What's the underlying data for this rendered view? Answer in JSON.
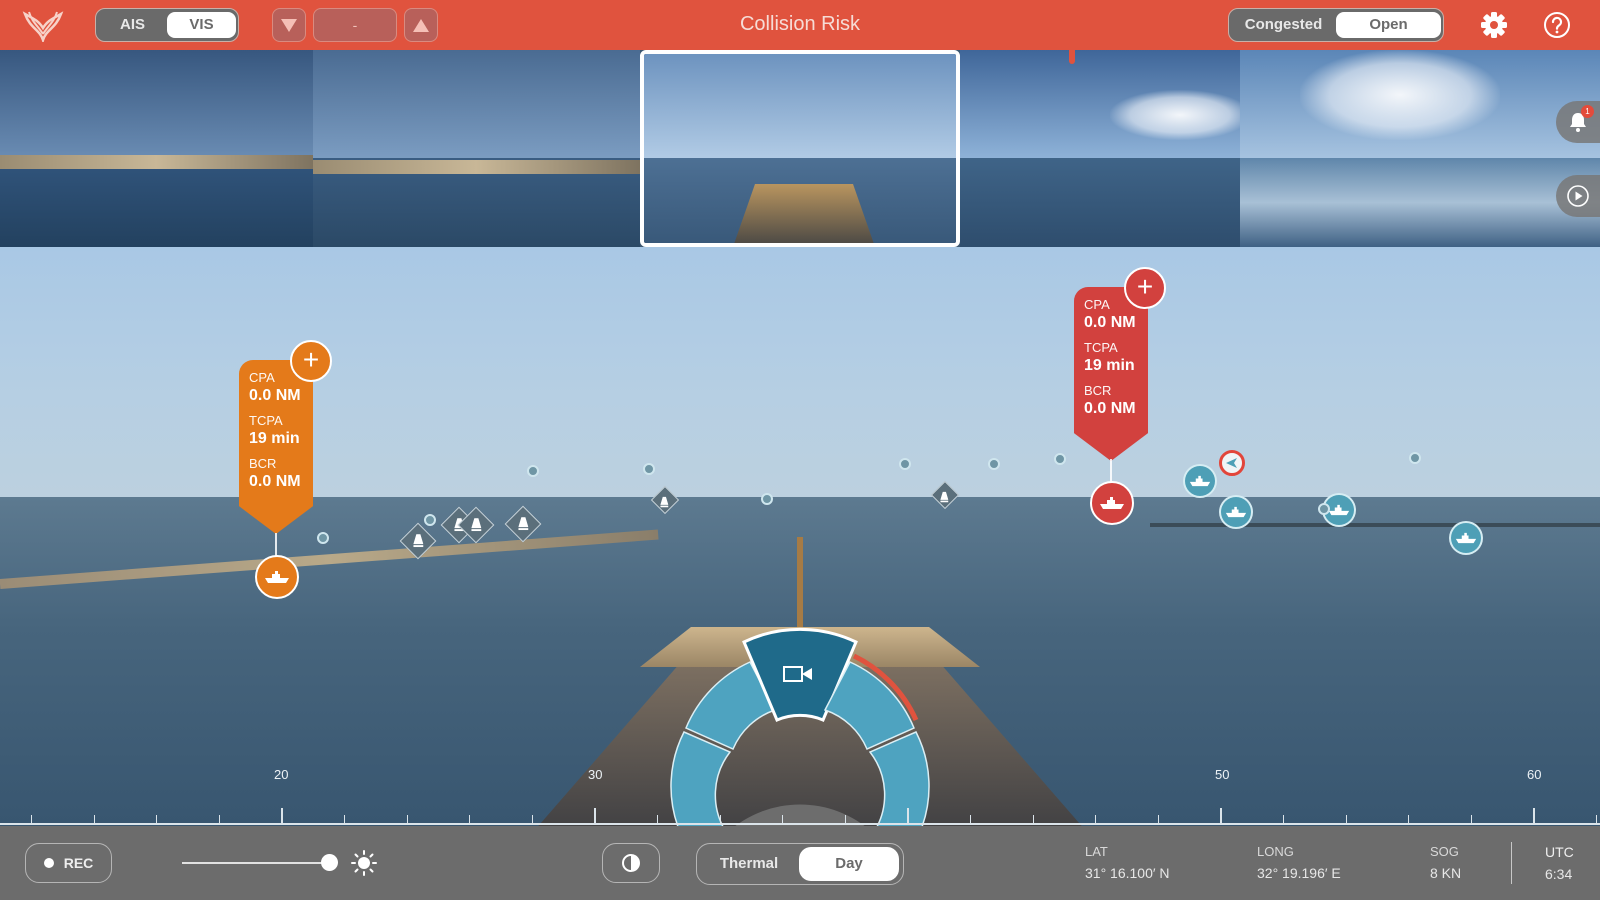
{
  "header": {
    "title": "Collision Risk",
    "source_toggle": {
      "options": [
        "AIS",
        "VIS"
      ],
      "selected": "VIS"
    },
    "range_control": {
      "value": "-",
      "decrease_icon": "triangle-down-icon",
      "increase_icon": "triangle-up-icon"
    },
    "traffic_toggle": {
      "options": [
        "Congested",
        "Open"
      ],
      "selected": "Open"
    },
    "icons": {
      "settings": "gear-icon",
      "help": "help-icon",
      "logo": "whale-tail-logo"
    }
  },
  "camera_strip": {
    "thumbnails": [
      {
        "id": "cam-1",
        "selected": false
      },
      {
        "id": "cam-2",
        "selected": false
      },
      {
        "id": "cam-3",
        "selected": true
      },
      {
        "id": "cam-4",
        "selected": false
      },
      {
        "id": "cam-5",
        "selected": false
      }
    ],
    "notifications": {
      "icon": "bell-icon",
      "count": "1"
    },
    "play_icon": "play-icon"
  },
  "targets": [
    {
      "color": "orange",
      "cpa_label": "CPA",
      "cpa": "0.0 NM",
      "tcpa_label": "TCPA",
      "tcpa": "19 min",
      "bcr_label": "BCR",
      "bcr": "0.0 NM"
    },
    {
      "color": "red",
      "cpa_label": "CPA",
      "cpa": "0.0 NM",
      "tcpa_label": "TCPA",
      "tcpa": "19 min",
      "bcr_label": "BCR",
      "bcr": "0.0 NM"
    }
  ],
  "colors": {
    "accent": "#e0533e",
    "warning": "#e47a1a",
    "danger": "#d2413e",
    "vessel": "#4e9fb6",
    "dial_active": "#1f6a8a"
  },
  "bearing_scale": {
    "labels": [
      "20",
      "30",
      "50",
      "60"
    ]
  },
  "bottom_bar": {
    "rec_label": "REC",
    "brightness": 0.97,
    "mode_toggle": {
      "options": [
        "Thermal",
        "Day"
      ],
      "selected": "Day"
    },
    "nav": [
      {
        "key": "LAT",
        "value": "31° 16.100′ N"
      },
      {
        "key": "LONG",
        "value": "32° 19.196′ E"
      },
      {
        "key": "SOG",
        "value": "8 KN"
      }
    ],
    "utc": {
      "key": "UTC",
      "value": "6:34"
    }
  }
}
